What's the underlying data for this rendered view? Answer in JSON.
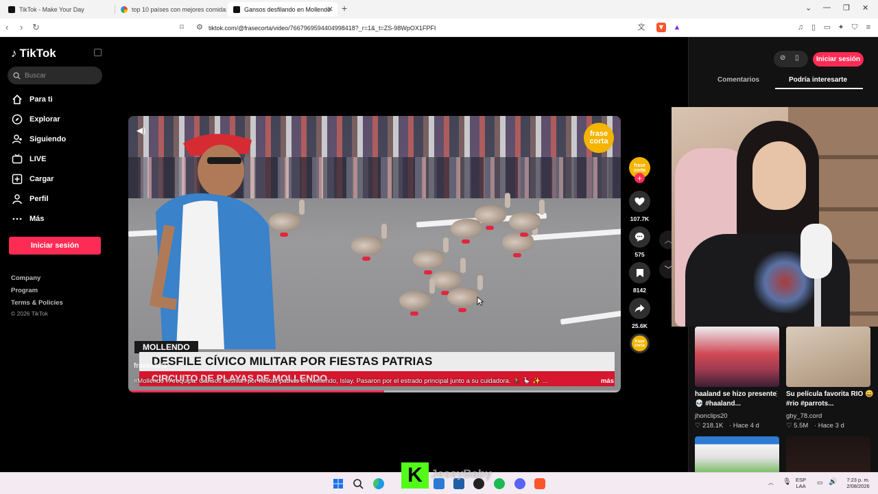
{
  "browser": {
    "tabs": [
      {
        "title": "TikTok - Make Your Day"
      },
      {
        "title": "top 10 países con mejores comidas"
      },
      {
        "title": "Gansos desfilando en Mollendo"
      }
    ],
    "url": "tiktok.com/@frasecorta/video/7667969594404998418?_r=1&_t=ZS-98WpOX1FPFI"
  },
  "sidebar": {
    "logo": "TikTok",
    "search_placeholder": "Buscar",
    "nav": [
      {
        "label": "Para ti",
        "icon": "home-icon"
      },
      {
        "label": "Explorar",
        "icon": "compass-icon"
      },
      {
        "label": "Siguiendo",
        "icon": "user-follow-icon"
      },
      {
        "label": "LIVE",
        "icon": "live-icon"
      },
      {
        "label": "Cargar",
        "icon": "upload-icon"
      },
      {
        "label": "Perfil",
        "icon": "profile-icon"
      },
      {
        "label": "Más",
        "icon": "more-icon"
      }
    ],
    "login_label": "Iniciar sesión",
    "footer_links": [
      "Company",
      "Program",
      "Terms & Policies"
    ],
    "copyright": "© 2026 TikTok"
  },
  "video": {
    "brand_line1": "frase",
    "brand_line2": "corta",
    "lower_tag": "MOLLENDO",
    "headline": "DESFILE CÍVICO MILITAR POR FIESTAS PATRIAS",
    "subline": "CIRCUITO DE PLAYAS DE MOLLENDO",
    "author": "frasecorta",
    "caption": "#Mollendo #Arequipa: Gansos desfilan por fiestas patrias en Mollendo, Islay. Pasaron por el estrado principal junto a su cuidadora. 🏃 🪿 ✨ ...",
    "more_label": "más",
    "progress": 0.52
  },
  "actions": {
    "likes": "107.7K",
    "comments": "575",
    "saves": "8142",
    "shares": "25.6K"
  },
  "right_panel": {
    "login_label": "Iniciar sesión",
    "tabs": [
      "Comentarios",
      "Podría interesarte"
    ],
    "cards": [
      {
        "title": "haaland se hizo presente 💀 #haaland...",
        "user": "jhonclips20",
        "likes": "218.1K",
        "age": "Hace 4 d"
      },
      {
        "title": "Su película favorita RIO 😄 #rio #parrots...",
        "user": "gby_78.cord",
        "likes": "5.5M",
        "age": "Hace 3 d"
      }
    ]
  },
  "taskbar": {
    "lang_line1": "ESP",
    "lang_line2": "LAA",
    "time": "7:23 p. m.",
    "date": "2/08/2026"
  },
  "overlay": {
    "kick_letter": "K",
    "streamer": "JessyBaby"
  },
  "colors": {
    "accent": "#fe2c55",
    "brand": "#f4b400",
    "kick": "#53fc18"
  }
}
